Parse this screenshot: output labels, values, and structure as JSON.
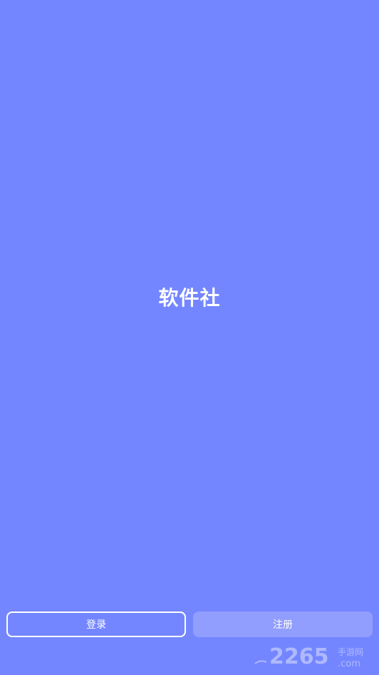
{
  "app": {
    "title": "软件社"
  },
  "buttons": {
    "login_label": "登录",
    "register_label": "注册"
  },
  "watermark": {
    "text": "2265",
    "suffix": "手游网",
    "domain": ".com"
  },
  "colors": {
    "background": "#7486ff",
    "register_button": "#929efd",
    "text": "#ffffff"
  }
}
